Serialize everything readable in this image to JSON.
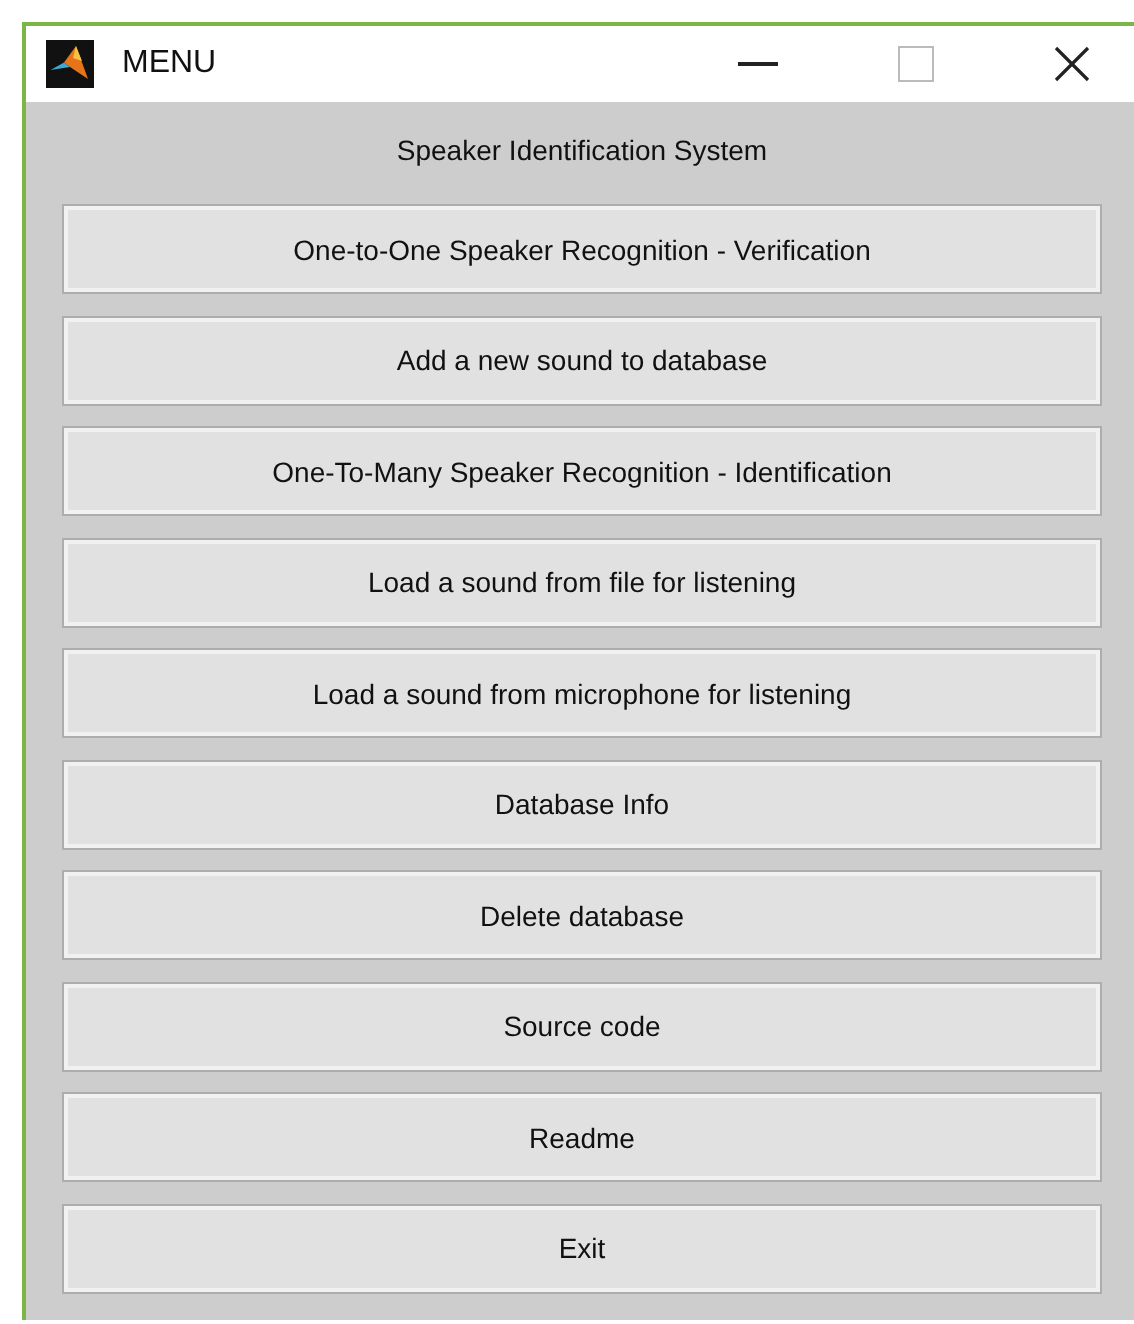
{
  "window": {
    "title": "MENU"
  },
  "heading": "Speaker Identification System",
  "buttons": [
    "One-to-One Speaker Recognition - Verification",
    "Add a new sound to database",
    "One-To-Many Speaker Recognition - Identification",
    "Load a sound from file for listening",
    "Load a sound from microphone for listening",
    "Database Info",
    "Delete database",
    "Source code",
    "Readme",
    "Exit"
  ]
}
